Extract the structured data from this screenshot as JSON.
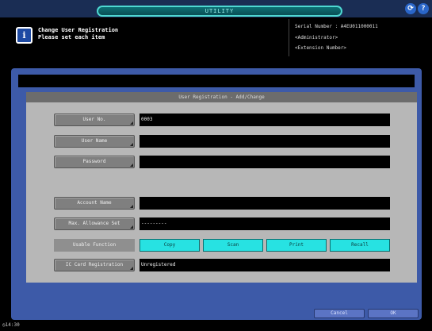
{
  "header": {
    "title": "UTILITY",
    "message_line1": "Change User Registration",
    "message_line2": "Please set each item",
    "serial_label": "Serial Number  :  A4EU011000011",
    "role": "<Administrator>",
    "extension": "<Extension Number>"
  },
  "icons": {
    "info": "i",
    "status": "status-icon",
    "help": "?"
  },
  "panel": {
    "title": "User Registration - Add/Change",
    "fields": [
      {
        "label": "User No.",
        "value": "0003"
      },
      {
        "label": "User Name",
        "value": ""
      },
      {
        "label": "Password",
        "value": ""
      },
      {
        "label": "Account Name",
        "value": ""
      },
      {
        "label": "Max. Allowance Set",
        "value": "---------"
      }
    ],
    "usable_function_label": "Usable Function",
    "functions": [
      "Copy",
      "Scan",
      "Print",
      "Recall"
    ],
    "ic_card": {
      "label": "IC Card Registration",
      "value": "Unregistered"
    }
  },
  "footer": {
    "cancel": "Cancel",
    "ok": "OK",
    "clock": "14:30"
  },
  "colors": {
    "accent_cyan": "#27e2e2",
    "panel_blue": "#3d5aa8",
    "info_blue": "#1e4aa3"
  }
}
